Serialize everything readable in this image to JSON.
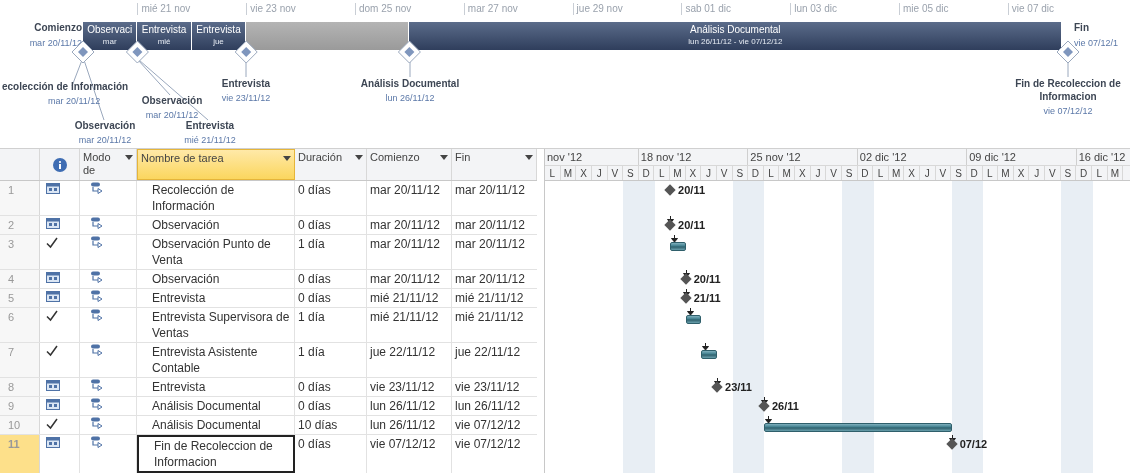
{
  "timeline": {
    "ticks": [
      "mié 21 nov",
      "vie 23 nov",
      "dom 25 nov",
      "mar 27 nov",
      "jue 29 nov",
      "sab 01 dic",
      "lun 03 dic",
      "mie 05 dic",
      "vie 07 dic"
    ],
    "start": {
      "label": "Comienzo",
      "date": "mar 20/11/12"
    },
    "finish": {
      "label": "Fin",
      "date": "vie 07/12/1"
    },
    "bars": [
      {
        "kind": "task",
        "name": "Observaci",
        "sub": "mar"
      },
      {
        "kind": "task",
        "name": "Entrevista",
        "sub": "mié"
      },
      {
        "kind": "task",
        "name": "Entrevista",
        "sub": "jue"
      },
      {
        "kind": "gap"
      },
      {
        "kind": "task",
        "name": "Análisis Documental",
        "sub": "lun 26/11/12 - vie 07/12/12"
      }
    ],
    "milestones": [
      {
        "name": "ecolección de Información",
        "date": "mar 20/11/12"
      },
      {
        "name": "Observación",
        "date": "mar 20/11/12"
      },
      {
        "name": "Observación",
        "date": "mar 20/11/12"
      },
      {
        "name": "Entrevista",
        "date": "mié 21/11/12"
      },
      {
        "name": "Entrevista",
        "date": "vie 23/11/12"
      },
      {
        "name": "Análisis Documental",
        "date": "lun 26/11/12"
      },
      {
        "name": "Fin de Recoleccion de Informacion",
        "date": "vie 07/12/12"
      }
    ]
  },
  "table": {
    "columns": [
      {
        "label": "Modo de",
        "selected": false
      },
      {
        "label": "Nombre de tarea",
        "selected": true
      },
      {
        "label": "Duración",
        "selected": false
      },
      {
        "label": "Comienzo",
        "selected": false
      },
      {
        "label": "Fin",
        "selected": false
      }
    ],
    "rows": [
      {
        "num": "1",
        "completed": false,
        "name": "Recolección de Información",
        "duration": "0 días",
        "start": "mar 20/11/12",
        "finish": "mar 20/11/12",
        "selected": false,
        "gantt": {
          "kind": "milestone",
          "label": "20/11"
        }
      },
      {
        "num": "2",
        "completed": false,
        "name": "Observación",
        "duration": "0 días",
        "start": "mar 20/11/12",
        "finish": "mar 20/11/12",
        "selected": false,
        "gantt": {
          "kind": "milestone",
          "label": "20/11"
        }
      },
      {
        "num": "3",
        "completed": true,
        "name": "Observación Punto de Venta",
        "duration": "1 día",
        "start": "mar 20/11/12",
        "finish": "mar 20/11/12",
        "selected": false,
        "gantt": {
          "kind": "bar"
        }
      },
      {
        "num": "4",
        "completed": false,
        "name": "Observación",
        "duration": "0 días",
        "start": "mar 20/11/12",
        "finish": "mar 20/11/12",
        "selected": false,
        "gantt": {
          "kind": "milestone",
          "label": "20/11"
        }
      },
      {
        "num": "5",
        "completed": false,
        "name": "Entrevista",
        "duration": "0 días",
        "start": "mié 21/11/12",
        "finish": "mié 21/11/12",
        "selected": false,
        "gantt": {
          "kind": "milestone",
          "label": "21/11"
        }
      },
      {
        "num": "6",
        "completed": true,
        "name": "Entrevista Supervisora de Ventas",
        "duration": "1 día",
        "start": "mié 21/11/12",
        "finish": "mié 21/11/12",
        "selected": false,
        "gantt": {
          "kind": "bar"
        }
      },
      {
        "num": "7",
        "completed": true,
        "name": "Entrevista Asistente Contable",
        "duration": "1 día",
        "start": "jue 22/11/12",
        "finish": "jue 22/11/12",
        "selected": false,
        "gantt": {
          "kind": "bar"
        }
      },
      {
        "num": "8",
        "completed": false,
        "name": "Entrevista",
        "duration": "0 días",
        "start": "vie 23/11/12",
        "finish": "vie 23/11/12",
        "selected": false,
        "gantt": {
          "kind": "milestone",
          "label": "23/11"
        }
      },
      {
        "num": "9",
        "completed": false,
        "name": "Análisis Documental",
        "duration": "0 días",
        "start": "lun 26/11/12",
        "finish": "lun 26/11/12",
        "selected": false,
        "gantt": {
          "kind": "milestone",
          "label": "26/11"
        }
      },
      {
        "num": "10",
        "completed": true,
        "name": "Análisis Documental",
        "duration": "10 días",
        "start": "lun 26/11/12",
        "finish": "vie 07/12/12",
        "selected": false,
        "gantt": {
          "kind": "bar"
        }
      },
      {
        "num": "11",
        "completed": false,
        "name": "Fin de Recoleccion de Informacion",
        "duration": "0 días",
        "start": "vie 07/12/12",
        "finish": "vie 07/12/12",
        "selected": true,
        "gantt": {
          "kind": "milestone",
          "label": "07/12"
        }
      }
    ]
  },
  "gantt": {
    "weeks": [
      "nov '12",
      "18 nov '12",
      "25 nov '12",
      "02 dic '12",
      "09 dic '12",
      "16 dic '12"
    ],
    "days": [
      "L",
      "M",
      "X",
      "J",
      "V",
      "S",
      "D",
      "L",
      "M",
      "X",
      "J",
      "V",
      "S",
      "D",
      "L",
      "M",
      "X",
      "J",
      "V",
      "S",
      "D",
      "L",
      "M",
      "X",
      "J",
      "V",
      "S",
      "D",
      "L",
      "M",
      "X",
      "J",
      "V",
      "S",
      "D",
      "L",
      "M"
    ]
  }
}
